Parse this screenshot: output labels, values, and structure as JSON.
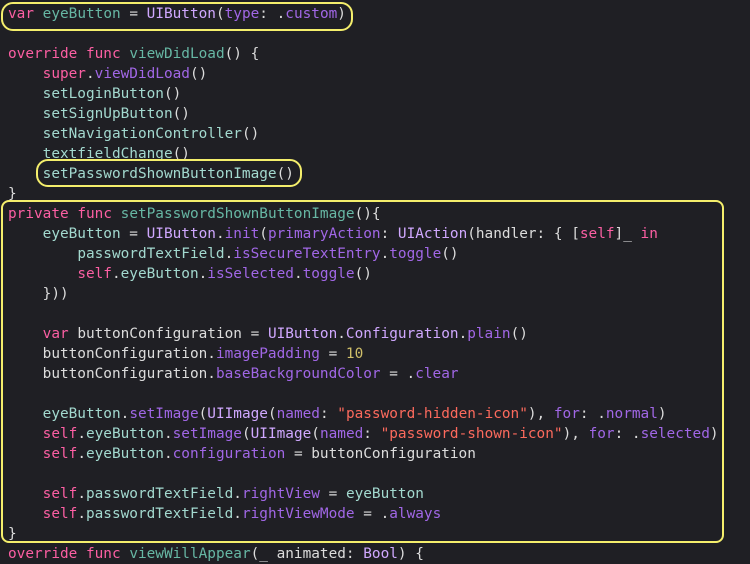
{
  "theme": {
    "background": "#1f1f24",
    "highlight_color": "#f4ee6c",
    "token_colors": {
      "kw": "#fc5fa3",
      "decl": "#67b7a4",
      "prop": "#a3d9cf",
      "type": "#d0a8ff",
      "func": "#a3d9cf",
      "plain": "#dcdcdc",
      "str": "#fc6a5d",
      "num": "#d0bf69",
      "member": "#a167e6"
    }
  },
  "code_lines": [
    {
      "indent": "",
      "tokens": [
        [
          "kw",
          "var"
        ],
        [
          "plain",
          " "
        ],
        [
          "decl",
          "eyeButton"
        ],
        [
          "plain",
          " = "
        ],
        [
          "type",
          "UIButton"
        ],
        [
          "plain",
          "("
        ],
        [
          "member",
          "type"
        ],
        [
          "plain",
          ": ."
        ],
        [
          "member",
          "custom"
        ],
        [
          "plain",
          ")"
        ]
      ]
    },
    {
      "indent": "",
      "tokens": []
    },
    {
      "indent": "",
      "tokens": [
        [
          "kw",
          "override"
        ],
        [
          "plain",
          " "
        ],
        [
          "kw",
          "func"
        ],
        [
          "plain",
          " "
        ],
        [
          "decl",
          "viewDidLoad"
        ],
        [
          "plain",
          "() {"
        ]
      ]
    },
    {
      "indent": "    ",
      "tokens": [
        [
          "kw",
          "super"
        ],
        [
          "plain",
          "."
        ],
        [
          "member",
          "viewDidLoad"
        ],
        [
          "plain",
          "()"
        ]
      ]
    },
    {
      "indent": "    ",
      "tokens": [
        [
          "func",
          "setLoginButton"
        ],
        [
          "plain",
          "()"
        ]
      ]
    },
    {
      "indent": "    ",
      "tokens": [
        [
          "func",
          "setSignUpButton"
        ],
        [
          "plain",
          "()"
        ]
      ]
    },
    {
      "indent": "    ",
      "tokens": [
        [
          "func",
          "setNavigationController"
        ],
        [
          "plain",
          "()"
        ]
      ]
    },
    {
      "indent": "    ",
      "tokens": [
        [
          "func",
          "textfieldChange"
        ],
        [
          "plain",
          "()"
        ]
      ]
    },
    {
      "indent": "    ",
      "tokens": [
        [
          "func",
          "setPasswordShownButtonImage"
        ],
        [
          "plain",
          "()"
        ]
      ]
    },
    {
      "indent": "",
      "tokens": [
        [
          "plain",
          "}"
        ]
      ]
    },
    {
      "indent": "",
      "tokens": [
        [
          "kw",
          "private"
        ],
        [
          "plain",
          " "
        ],
        [
          "kw",
          "func"
        ],
        [
          "plain",
          " "
        ],
        [
          "decl",
          "setPasswordShownButtonImage"
        ],
        [
          "plain",
          "(){"
        ]
      ]
    },
    {
      "indent": "    ",
      "tokens": [
        [
          "prop",
          "eyeButton"
        ],
        [
          "plain",
          " = "
        ],
        [
          "type",
          "UIButton"
        ],
        [
          "plain",
          "."
        ],
        [
          "member",
          "init"
        ],
        [
          "plain",
          "("
        ],
        [
          "member",
          "primaryAction"
        ],
        [
          "plain",
          ": "
        ],
        [
          "type",
          "UIAction"
        ],
        [
          "plain",
          "(handler: { ["
        ],
        [
          "kw",
          "self"
        ],
        [
          "plain",
          "]_ "
        ],
        [
          "kw",
          "in"
        ]
      ]
    },
    {
      "indent": "        ",
      "tokens": [
        [
          "prop",
          "passwordTextField"
        ],
        [
          "plain",
          "."
        ],
        [
          "member",
          "isSecureTextEntry"
        ],
        [
          "plain",
          "."
        ],
        [
          "member",
          "toggle"
        ],
        [
          "plain",
          "()"
        ]
      ]
    },
    {
      "indent": "        ",
      "tokens": [
        [
          "kw",
          "self"
        ],
        [
          "plain",
          "."
        ],
        [
          "prop",
          "eyeButton"
        ],
        [
          "plain",
          "."
        ],
        [
          "member",
          "isSelected"
        ],
        [
          "plain",
          "."
        ],
        [
          "member",
          "toggle"
        ],
        [
          "plain",
          "()"
        ]
      ]
    },
    {
      "indent": "    ",
      "tokens": [
        [
          "plain",
          "}))"
        ]
      ]
    },
    {
      "indent": "",
      "tokens": []
    },
    {
      "indent": "    ",
      "tokens": [
        [
          "kw",
          "var"
        ],
        [
          "plain",
          " buttonConfiguration = "
        ],
        [
          "type",
          "UIButton"
        ],
        [
          "plain",
          "."
        ],
        [
          "type",
          "Configuration"
        ],
        [
          "plain",
          "."
        ],
        [
          "member",
          "plain"
        ],
        [
          "plain",
          "()"
        ]
      ]
    },
    {
      "indent": "    ",
      "tokens": [
        [
          "plain",
          "buttonConfiguration."
        ],
        [
          "member",
          "imagePadding"
        ],
        [
          "plain",
          " = "
        ],
        [
          "num",
          "10"
        ]
      ]
    },
    {
      "indent": "    ",
      "tokens": [
        [
          "plain",
          "buttonConfiguration."
        ],
        [
          "member",
          "baseBackgroundColor"
        ],
        [
          "plain",
          " = ."
        ],
        [
          "member",
          "clear"
        ]
      ]
    },
    {
      "indent": "",
      "tokens": []
    },
    {
      "indent": "    ",
      "tokens": [
        [
          "prop",
          "eyeButton"
        ],
        [
          "plain",
          "."
        ],
        [
          "member",
          "setImage"
        ],
        [
          "plain",
          "("
        ],
        [
          "type",
          "UIImage"
        ],
        [
          "plain",
          "("
        ],
        [
          "member",
          "named"
        ],
        [
          "plain",
          ": "
        ],
        [
          "str",
          "\"password-hidden-icon\""
        ],
        [
          "plain",
          "), "
        ],
        [
          "member",
          "for"
        ],
        [
          "plain",
          ": ."
        ],
        [
          "member",
          "normal"
        ],
        [
          "plain",
          ")"
        ]
      ]
    },
    {
      "indent": "    ",
      "tokens": [
        [
          "kw",
          "self"
        ],
        [
          "plain",
          "."
        ],
        [
          "prop",
          "eyeButton"
        ],
        [
          "plain",
          "."
        ],
        [
          "member",
          "setImage"
        ],
        [
          "plain",
          "("
        ],
        [
          "type",
          "UIImage"
        ],
        [
          "plain",
          "("
        ],
        [
          "member",
          "named"
        ],
        [
          "plain",
          ": "
        ],
        [
          "str",
          "\"password-shown-icon\""
        ],
        [
          "plain",
          "), "
        ],
        [
          "member",
          "for"
        ],
        [
          "plain",
          ": ."
        ],
        [
          "member",
          "selected"
        ],
        [
          "plain",
          ")"
        ]
      ]
    },
    {
      "indent": "    ",
      "tokens": [
        [
          "kw",
          "self"
        ],
        [
          "plain",
          "."
        ],
        [
          "prop",
          "eyeButton"
        ],
        [
          "plain",
          "."
        ],
        [
          "member",
          "configuration"
        ],
        [
          "plain",
          " = buttonConfiguration"
        ]
      ]
    },
    {
      "indent": "",
      "tokens": []
    },
    {
      "indent": "    ",
      "tokens": [
        [
          "kw",
          "self"
        ],
        [
          "plain",
          "."
        ],
        [
          "prop",
          "passwordTextField"
        ],
        [
          "plain",
          "."
        ],
        [
          "member",
          "rightView"
        ],
        [
          "plain",
          " = "
        ],
        [
          "prop",
          "eyeButton"
        ]
      ]
    },
    {
      "indent": "    ",
      "tokens": [
        [
          "kw",
          "self"
        ],
        [
          "plain",
          "."
        ],
        [
          "prop",
          "passwordTextField"
        ],
        [
          "plain",
          "."
        ],
        [
          "member",
          "rightViewMode"
        ],
        [
          "plain",
          " = ."
        ],
        [
          "member",
          "always"
        ]
      ]
    },
    {
      "indent": "",
      "tokens": [
        [
          "plain",
          "}"
        ]
      ]
    },
    {
      "indent": "",
      "tokens": [
        [
          "kw",
          "override"
        ],
        [
          "plain",
          " "
        ],
        [
          "kw",
          "func"
        ],
        [
          "plain",
          " "
        ],
        [
          "decl",
          "viewWillAppear"
        ],
        [
          "plain",
          "(_ animated: "
        ],
        [
          "type",
          "Bool"
        ],
        [
          "plain",
          ") {"
        ]
      ]
    }
  ]
}
